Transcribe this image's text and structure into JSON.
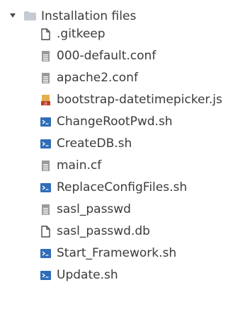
{
  "tree": {
    "folder": {
      "label": "Installation files",
      "expanded": true,
      "icon": "folder-icon",
      "icon_color": "#c6cbd3",
      "caret": "caret-down-icon"
    },
    "files": [
      {
        "label": ".gitkeep",
        "icon": "blank-file-icon"
      },
      {
        "label": "000-default.conf",
        "icon": "text-file-icon"
      },
      {
        "label": "apache2.conf",
        "icon": "text-file-icon"
      },
      {
        "label": "bootstrap-datetimepicker.js",
        "icon": "javascript-file-icon"
      },
      {
        "label": "ChangeRootPwd.sh",
        "icon": "shell-script-icon"
      },
      {
        "label": "CreateDB.sh",
        "icon": "shell-script-icon"
      },
      {
        "label": "main.cf",
        "icon": "text-file-icon"
      },
      {
        "label": "ReplaceConfigFiles.sh",
        "icon": "shell-script-icon"
      },
      {
        "label": "sasl_passwd",
        "icon": "text-file-icon"
      },
      {
        "label": "sasl_passwd.db",
        "icon": "blank-file-icon"
      },
      {
        "label": "Start_Framework.sh",
        "icon": "shell-script-icon"
      },
      {
        "label": "Update.sh",
        "icon": "shell-script-icon"
      }
    ],
    "colors": {
      "text": "#3b3b3b",
      "shell_icon": "#2f6db8",
      "js_icon_top": "#d88a2a",
      "js_icon_bottom": "#c0392b",
      "text_icon": "#8a8a8a"
    }
  }
}
